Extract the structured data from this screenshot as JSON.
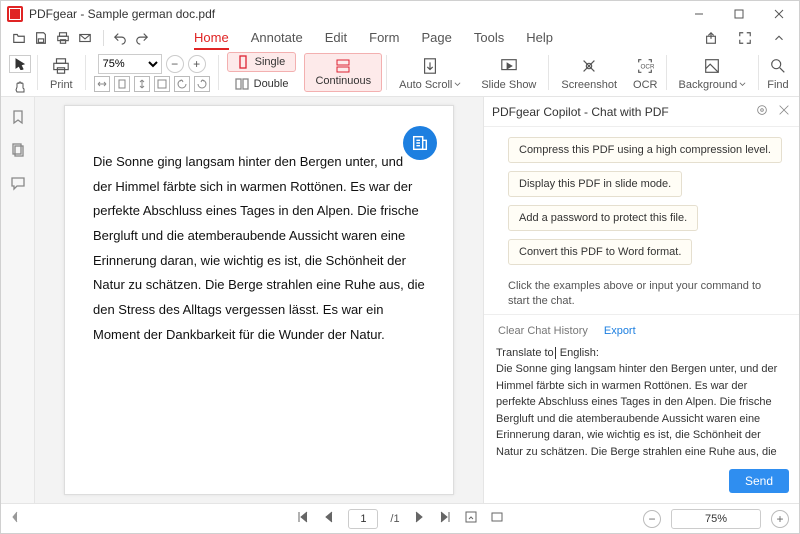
{
  "app": {
    "title": "PDFgear - Sample german doc.pdf"
  },
  "menu": {
    "items": [
      "Home",
      "Annotate",
      "Edit",
      "Form",
      "Page",
      "Tools",
      "Help"
    ],
    "active": "Home"
  },
  "ribbon": {
    "print": "Print",
    "zoom_value": "75%",
    "page_single": "Single",
    "page_double": "Double",
    "continuous": "Continuous",
    "autoscroll": "Auto Scroll",
    "slideshow": "Slide Show",
    "screenshot": "Screenshot",
    "ocr": "OCR",
    "background": "Background",
    "find": "Find"
  },
  "document": {
    "paragraph": "Die Sonne ging langsam hinter den Bergen unter, und der Himmel färbte sich in warmen Rottönen. Es war der perfekte Abschluss eines Tages in den Alpen. Die frische Bergluft und die atemberaubende Aussicht waren eine Erinnerung daran, wie wichtig es ist, die Schönheit der Natur zu schätzen. Die Berge strahlen eine Ruhe aus, die den Stress des Alltags vergessen lässt. Es war ein Moment der Dankbarkeit für die Wunder der Natur."
  },
  "copilot": {
    "title": "PDFgear Copilot - Chat with PDF",
    "suggestions": [
      "Compress this PDF using a high compression level.",
      "Display this PDF in slide mode.",
      "Add a password to protect this file.",
      "Convert this PDF to Word format."
    ],
    "hint": "Click the examples above or input your command to start the chat.",
    "clear": "Clear Chat History",
    "export": "Export",
    "input_prefix": "Translate to",
    "input_suffix": " English:",
    "input_body": "Die Sonne ging langsam hinter den Bergen unter, und der Himmel färbte sich in warmen Rottönen. Es war der perfekte Abschluss eines Tages in den Alpen. Die frische Bergluft und die atemberaubende Aussicht waren eine Erinnerung daran, wie wichtig es ist, die Schönheit der Natur zu schätzen. Die Berge strahlen eine Ruhe aus, die den Stress des Alltags vergessen lässt. Es war ein",
    "send": "Send"
  },
  "footer": {
    "page_current": "1",
    "page_total": "/1",
    "zoom": "75%"
  }
}
